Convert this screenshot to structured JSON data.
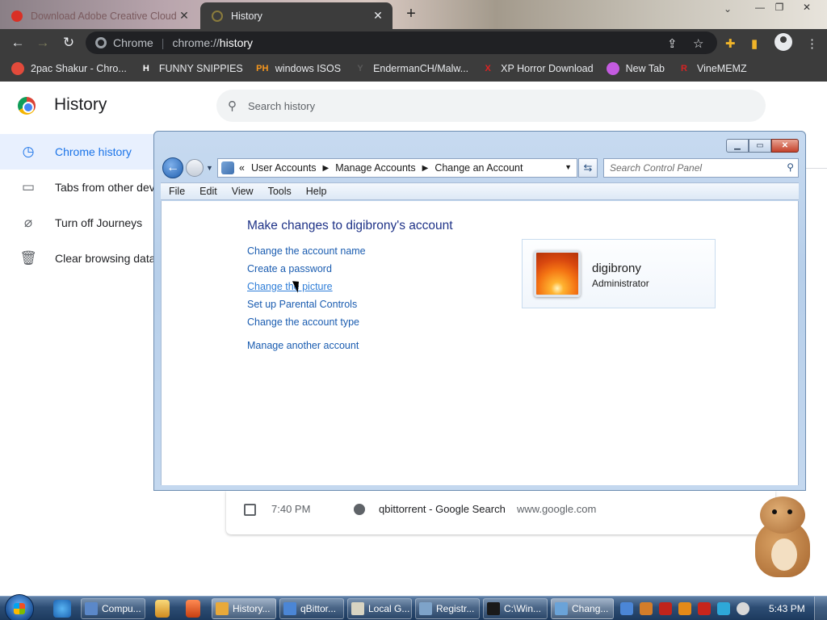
{
  "chrome": {
    "tabs": [
      {
        "title": "Download Adobe Creative Cloud",
        "active": false
      },
      {
        "title": "History",
        "active": true
      }
    ],
    "omnibox": {
      "site": "Chrome",
      "scheme": "chrome://",
      "path": "history"
    },
    "bookmarks": [
      {
        "label": "2pac Shakur - Chro...",
        "icon": "bookmark-red-icon",
        "glyph": "",
        "color": "#e24a3b"
      },
      {
        "label": "FUNNY SNIPPIES",
        "icon": "h-logo-icon",
        "glyph": "H",
        "color": "#ffffff"
      },
      {
        "label": "windows ISOS",
        "icon": "ph-logo-icon",
        "glyph": "PH",
        "color": "#f7971d"
      },
      {
        "label": "EndermanCH/Malw...",
        "icon": "yp-logo-icon",
        "glyph": "Y",
        "color": "#5a5a5a"
      },
      {
        "label": "XP Horror Download",
        "icon": "x-logo-icon",
        "glyph": "X",
        "color": "#e02323"
      },
      {
        "label": "New Tab",
        "icon": "new-tab-icon",
        "glyph": "",
        "color": "#c45be0"
      },
      {
        "label": "VineMEMZ",
        "icon": "r-logo-icon",
        "glyph": "R",
        "color": "#d62424"
      }
    ]
  },
  "history": {
    "title": "History",
    "search_placeholder": "Search history",
    "sidebar": [
      {
        "label": "Chrome history",
        "icon": "clock-icon",
        "active": true
      },
      {
        "label": "Tabs from other dev",
        "icon": "devices-icon",
        "active": false
      },
      {
        "label": "Turn off Journeys",
        "icon": "journeys-off-icon",
        "active": false
      },
      {
        "label": "Clear browsing data",
        "icon": "trash-icon",
        "active": false
      }
    ],
    "entries": [
      {
        "time": "7:40 PM",
        "title": "qbittorrent - Google Search",
        "domain": "www.google.com"
      }
    ]
  },
  "control_panel": {
    "breadcrumbs": [
      "User Accounts",
      "Manage Accounts",
      "Change an Account"
    ],
    "search_placeholder": "Search Control Panel",
    "menu": [
      "File",
      "Edit",
      "View",
      "Tools",
      "Help"
    ],
    "heading": "Make changes to digibrony's account",
    "links": [
      "Change the account name",
      "Create a password",
      "Change the picture",
      "Set up Parental Controls",
      "Change the account type",
      "Manage another account"
    ],
    "account": {
      "name": "digibrony",
      "role": "Administrator"
    }
  },
  "taskbar": {
    "tasks": [
      {
        "label": "Compu...",
        "icon": "computer-icon",
        "color": "#5b88c9",
        "active": false
      },
      {
        "label": "History...",
        "icon": "chrome-icon",
        "color": "#e8a93a",
        "active": true
      },
      {
        "label": "qBittor...",
        "icon": "qbittorrent-icon",
        "color": "#4b86d6",
        "active": false
      },
      {
        "label": "Local G...",
        "icon": "policy-editor-icon",
        "color": "#d8d4c2",
        "active": false
      },
      {
        "label": "Registr...",
        "icon": "regedit-icon",
        "color": "#7ea3c9",
        "active": false
      },
      {
        "label": "C:\\Win...",
        "icon": "cmd-icon",
        "color": "#1a1a1a",
        "active": false
      },
      {
        "label": "Chang...",
        "icon": "user-accounts-icon",
        "color": "#6aa3d8",
        "active": true
      }
    ],
    "clock": "5:43 PM"
  }
}
